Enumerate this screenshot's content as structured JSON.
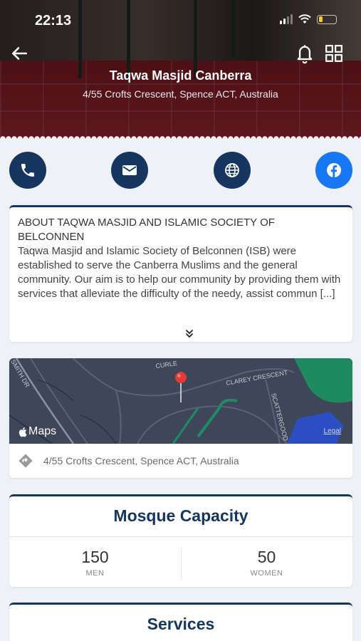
{
  "status_bar": {
    "time": "22:13"
  },
  "header": {
    "title": "Taqwa Masjid Canberra",
    "address": "4/55 Crofts Crescent, Spence ACT, Australia",
    "icons": [
      "back-arrow-icon",
      "bell-icon",
      "grid-icon"
    ]
  },
  "actions": [
    "phone-icon",
    "mail-icon",
    "globe-icon",
    "facebook-icon"
  ],
  "about": {
    "heading": "ABOUT TAQWA MASJID AND ISLAMIC SOCIETY OF BELCONNEN",
    "body": "Taqwa Masjid and Islamic Society of Belconnen (ISB) were established to serve the Canberra Muslims and the general community. Our aim is to help our community by providing them with services that alleviate the difficulty of the needy, assist commun [...]"
  },
  "map": {
    "logo_text": "Maps",
    "legal": "Legal",
    "streets": [
      "CURLE",
      "CLAREY CRESCENT",
      "SCATTERGOOD",
      "SMITH DR"
    ],
    "address": "4/55 Crofts Crescent, Spence ACT, Australia"
  },
  "capacity": {
    "title": "Mosque Capacity",
    "men": {
      "value": "150",
      "label": "MEN"
    },
    "women": {
      "value": "50",
      "label": "WOMEN"
    }
  },
  "services": {
    "title": "Services"
  },
  "colors": {
    "primary": "#16365f",
    "facebook": "#1877f2",
    "background": "#eef1f5",
    "pin": "#e53935"
  }
}
